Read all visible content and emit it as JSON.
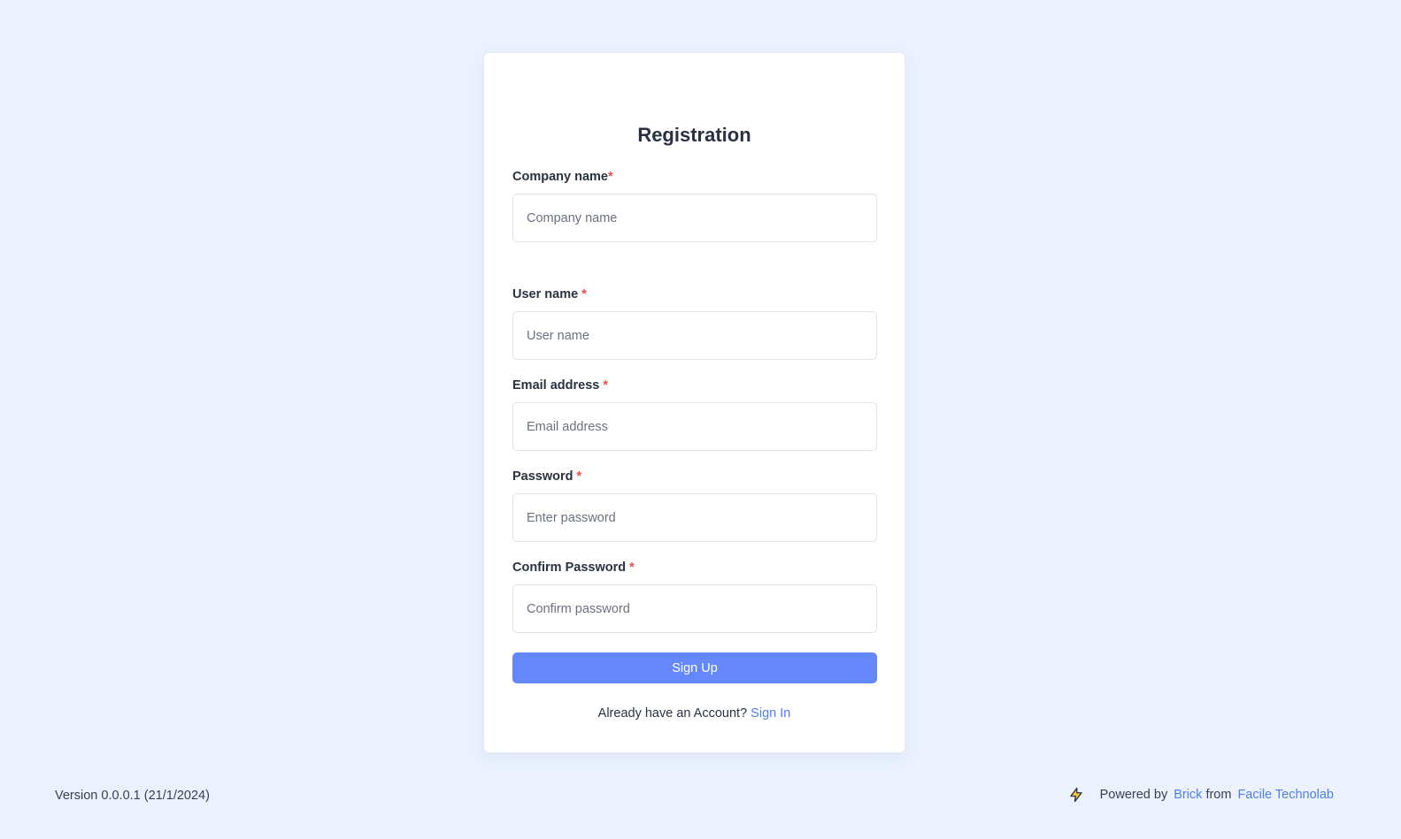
{
  "form": {
    "title": "Registration",
    "fields": [
      {
        "label": "Company name",
        "required_mark": "*",
        "placeholder": "Company name",
        "value": ""
      },
      {
        "label": "User name",
        "required_mark": "*",
        "placeholder": "User name",
        "value": ""
      },
      {
        "label": "Email address",
        "required_mark": "*",
        "placeholder": "Email address",
        "value": ""
      },
      {
        "label": "Password",
        "required_mark": "*",
        "placeholder": "Enter password",
        "value": ""
      },
      {
        "label": "Confirm Password",
        "required_mark": "*",
        "placeholder": "Confirm password",
        "value": ""
      }
    ],
    "submit_label": "Sign Up",
    "signin_prompt": "Already have an Account?",
    "signin_link": "Sign In"
  },
  "footer": {
    "version": "Version 0.0.0.1 (21/1/2024)",
    "powered_by": "Powered by",
    "brick_link": "Brick",
    "from_text": "from",
    "company_link": "Facile Technolab"
  },
  "icons": {
    "powered_icon": "lightning-bolt-icon"
  },
  "colors": {
    "background": "#ebf2fe",
    "primary_button": "#6488fb",
    "link": "#4f7ef0",
    "required": "#ef4b4b",
    "bolt_fill": "#f6c945"
  }
}
